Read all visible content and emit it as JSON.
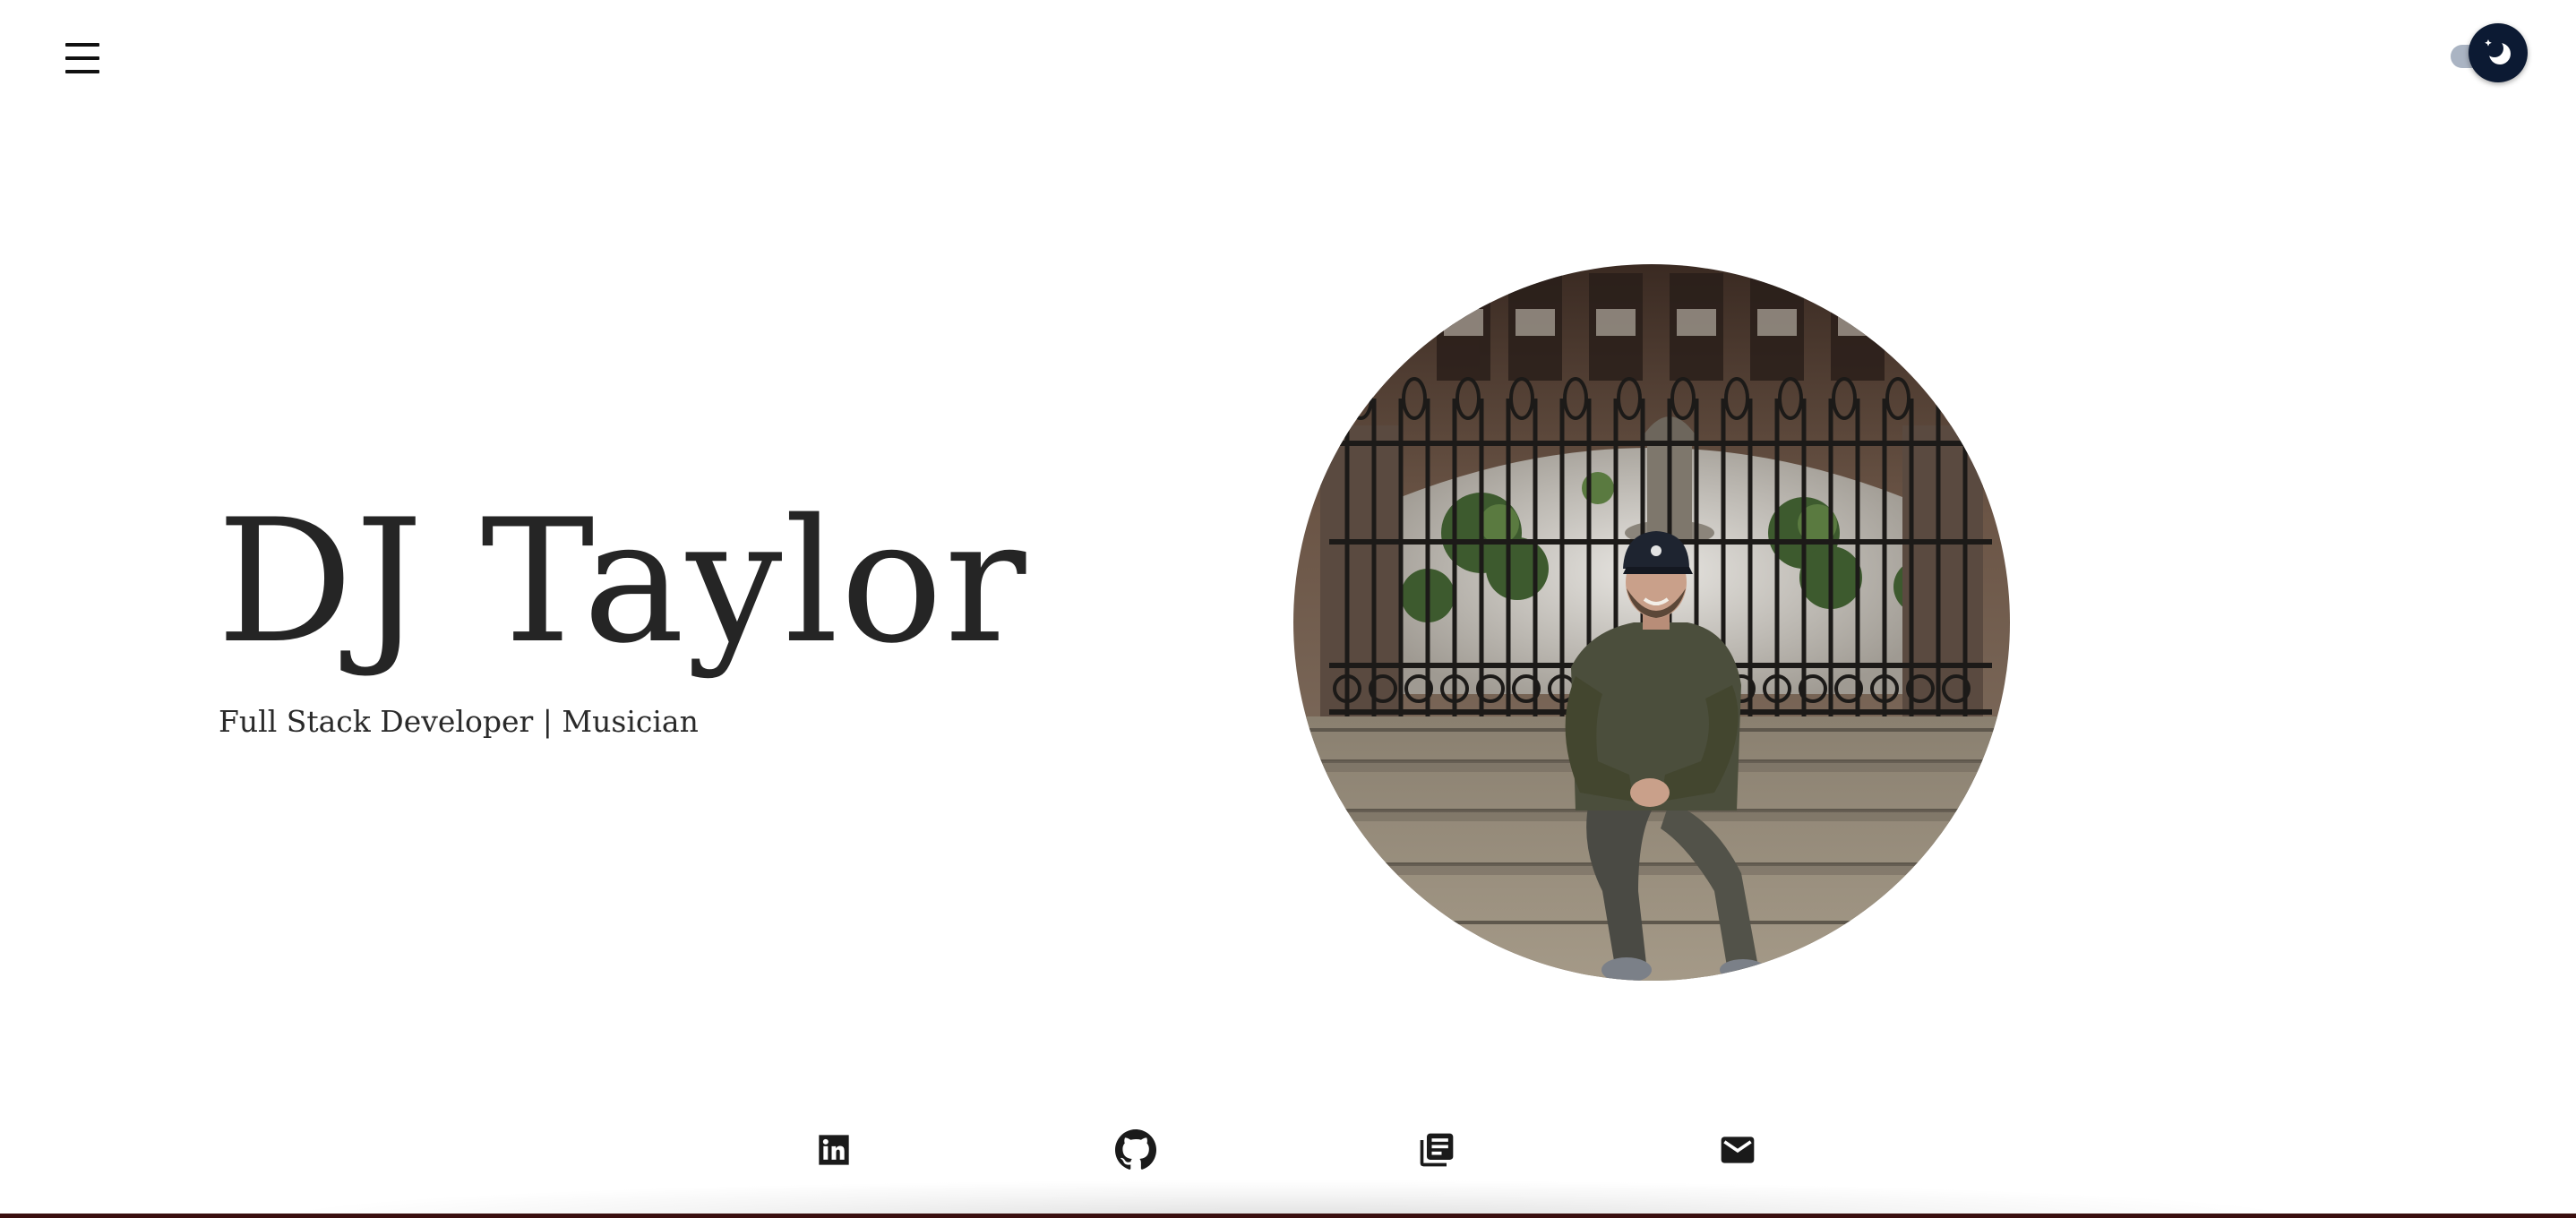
{
  "header": {
    "menu_icon": "hamburger-menu-icon",
    "theme_toggle": {
      "state": "dark-mode",
      "icon": "moon-icon",
      "colors": {
        "knob": "#0c1a33",
        "track": "#aab4c3"
      }
    }
  },
  "hero": {
    "name": "DJ Taylor",
    "subtitle": "Full Stack Developer | Musician",
    "portrait": {
      "subject": "man sitting on stone steps in front of an iron gate",
      "shape": "circle"
    }
  },
  "social_links": [
    {
      "name": "LinkedIn",
      "icon": "linkedin-icon"
    },
    {
      "name": "GitHub",
      "icon": "github-icon"
    },
    {
      "name": "Blog",
      "icon": "articles-icon"
    },
    {
      "name": "Email",
      "icon": "mail-icon"
    }
  ]
}
